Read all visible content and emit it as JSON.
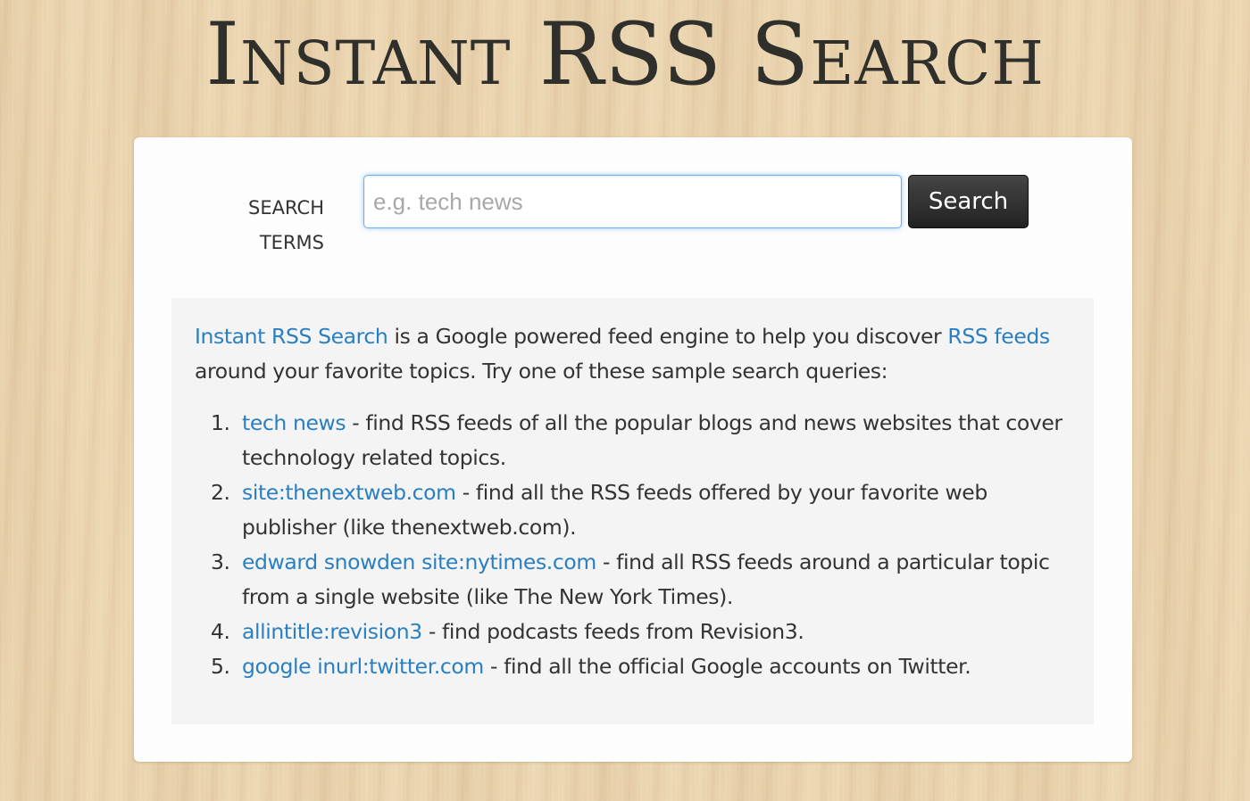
{
  "page": {
    "title": "Instant RSS Search"
  },
  "search": {
    "label": "SEARCH\nTERMS",
    "placeholder": "e.g. tech news",
    "value": "",
    "button_label": "Search"
  },
  "intro": {
    "link1": "Instant RSS Search",
    "text1": " is a Google powered feed engine to help you discover ",
    "link2": "RSS feeds",
    "text2": " around your favorite topics. Try one of these sample search queries:"
  },
  "samples": [
    {
      "num": "1.",
      "query": "tech news",
      "description": " - find RSS feeds of all the popular blogs and news websites that cover technology related topics."
    },
    {
      "num": "2.",
      "query": "site:thenextweb.com",
      "description": " - find all the RSS feeds offered by your favorite web publisher (like thenextweb.com)."
    },
    {
      "num": "3.",
      "query": "edward snowden site:nytimes.com",
      "description": " - find all RSS feeds around a particular topic from a single website (like The New York Times)."
    },
    {
      "num": "4.",
      "query": "allintitle:revision3",
      "description": " - find podcasts feeds from Revision3."
    },
    {
      "num": "5.",
      "query": "google inurl:twitter.com",
      "description": " - find all the official Google accounts on Twitter."
    }
  ],
  "colors": {
    "link": "#2a7fc1",
    "text": "#333333",
    "button_bg": "#2b2b2b",
    "focus_glow": "#52a8ec",
    "panel_bg": "#f4f4f4",
    "page_bg": "#ecd6b1"
  }
}
